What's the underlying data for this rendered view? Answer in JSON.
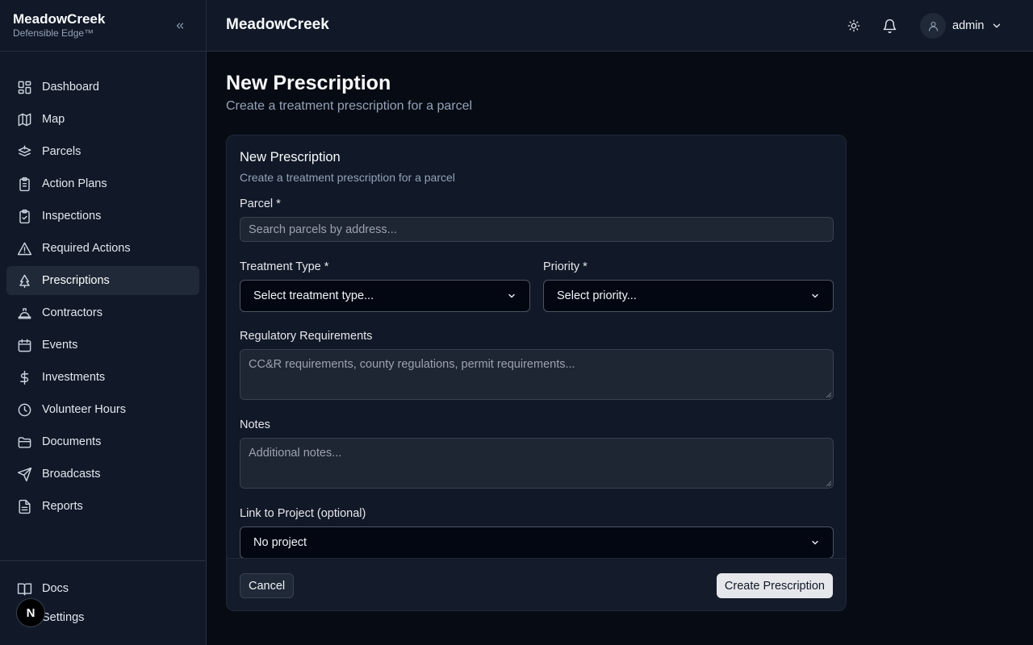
{
  "brand": {
    "name": "MeadowCreek",
    "tagline": "Defensible Edge™"
  },
  "header": {
    "title": "MeadowCreek",
    "user": "admin"
  },
  "sidebar": {
    "items": [
      {
        "label": "Dashboard",
        "icon": "dashboard-icon"
      },
      {
        "label": "Map",
        "icon": "map-icon"
      },
      {
        "label": "Parcels",
        "icon": "parcels-icon"
      },
      {
        "label": "Action Plans",
        "icon": "clipboard-icon"
      },
      {
        "label": "Inspections",
        "icon": "clipboard-check-icon"
      },
      {
        "label": "Required Actions",
        "icon": "warning-icon"
      },
      {
        "label": "Prescriptions",
        "icon": "tree-icon",
        "active": true
      },
      {
        "label": "Contractors",
        "icon": "hard-hat-icon"
      },
      {
        "label": "Events",
        "icon": "calendar-icon"
      },
      {
        "label": "Investments",
        "icon": "dollar-icon"
      },
      {
        "label": "Volunteer Hours",
        "icon": "clock-icon"
      },
      {
        "label": "Documents",
        "icon": "folder-icon"
      },
      {
        "label": "Broadcasts",
        "icon": "send-icon"
      },
      {
        "label": "Reports",
        "icon": "report-icon"
      }
    ],
    "bottom": [
      {
        "label": "Docs",
        "icon": "book-icon"
      },
      {
        "label": "Settings",
        "icon": "settings-icon"
      }
    ],
    "badge": "N"
  },
  "page": {
    "title": "New Prescription",
    "subtitle": "Create a treatment prescription for a parcel"
  },
  "card": {
    "title": "New Prescription",
    "subtitle": "Create a treatment prescription for a parcel",
    "parcel_label": "Parcel *",
    "parcel_placeholder": "Search parcels by address...",
    "treatment_label": "Treatment Type *",
    "treatment_value": "Select treatment type...",
    "priority_label": "Priority *",
    "priority_value": "Select priority...",
    "regulatory_label": "Regulatory Requirements",
    "regulatory_placeholder": "CC&R requirements, county regulations, permit requirements...",
    "notes_label": "Notes",
    "notes_placeholder": "Additional notes...",
    "project_label": "Link to Project (optional)",
    "project_value": "No project",
    "cancel_label": "Cancel",
    "create_label": "Create Prescription"
  }
}
